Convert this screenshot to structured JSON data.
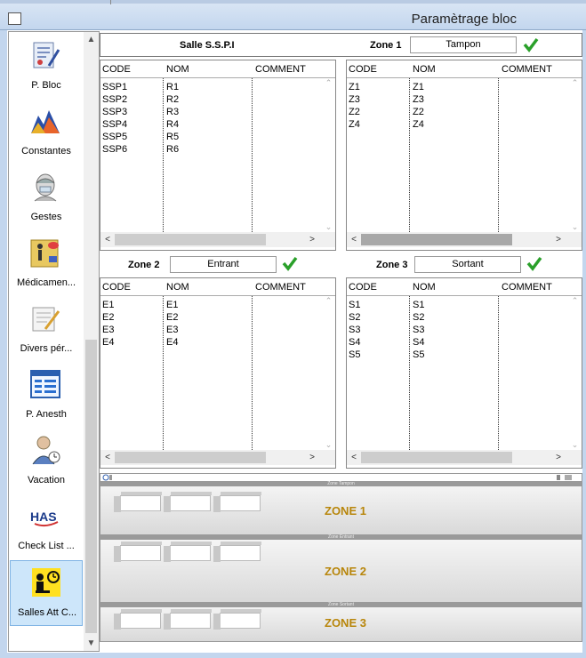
{
  "window": {
    "title": "Paramètrage bloc"
  },
  "sidebar": {
    "items": [
      {
        "label": "P. Bloc",
        "icon": "clipboard-pen-icon"
      },
      {
        "label": "Constantes",
        "icon": "mountain-chart-icon"
      },
      {
        "label": "Gestes",
        "icon": "surgeon-head-icon"
      },
      {
        "label": "Médicamen...",
        "icon": "medication-person-icon"
      },
      {
        "label": "Divers pér...",
        "icon": "notepad-pencil-icon"
      },
      {
        "label": "P. Anesth",
        "icon": "calendar-table-icon"
      },
      {
        "label": "Vacation",
        "icon": "doctor-clock-icon"
      },
      {
        "label": "Check List ...",
        "icon": "has-logo-icon"
      },
      {
        "label": "Salles Att C...",
        "icon": "waiting-room-icon"
      }
    ]
  },
  "header": {
    "salle_label": "Salle S.S.P.I",
    "zone1_label": "Zone 1",
    "zone1_value": "Tampon"
  },
  "mid": {
    "zone2_label": "Zone 2",
    "zone2_value": "Entrant",
    "zone3_label": "Zone 3",
    "zone3_value": "Sortant"
  },
  "columns": {
    "code": "CODE",
    "nom": "NOM",
    "comment": "COMMENT"
  },
  "grids": {
    "salle": [
      [
        "SSP1",
        "R1"
      ],
      [
        "SSP2",
        "R2"
      ],
      [
        "SSP3",
        "R3"
      ],
      [
        "SSP4",
        "R4"
      ],
      [
        "SSP5",
        "R5"
      ],
      [
        "SSP6",
        "R6"
      ]
    ],
    "zone1": [
      [
        "Z1",
        "Z1"
      ],
      [
        "Z3",
        "Z3"
      ],
      [
        "Z2",
        "Z2"
      ],
      [
        "Z4",
        "Z4"
      ]
    ],
    "zone2": [
      [
        "E1",
        "E1"
      ],
      [
        "E2",
        "E2"
      ],
      [
        "E3",
        "E3"
      ],
      [
        "E4",
        "E4"
      ]
    ],
    "zone3": [
      [
        "S1",
        "S1"
      ],
      [
        "S2",
        "S2"
      ],
      [
        "S3",
        "S3"
      ],
      [
        "S4",
        "S4"
      ],
      [
        "S5",
        "S5"
      ]
    ]
  },
  "preview": {
    "zones": [
      {
        "label": "ZONE 1",
        "bar_text": "Zone Tampon"
      },
      {
        "label": "ZONE 2",
        "bar_text": "Zone Entrant"
      },
      {
        "label": "ZONE 3",
        "bar_text": "Zone Sortant"
      }
    ]
  },
  "colors": {
    "accent_check": "#2aa02a",
    "zone_label": "#b8860b",
    "selection": "#cde6fa"
  }
}
